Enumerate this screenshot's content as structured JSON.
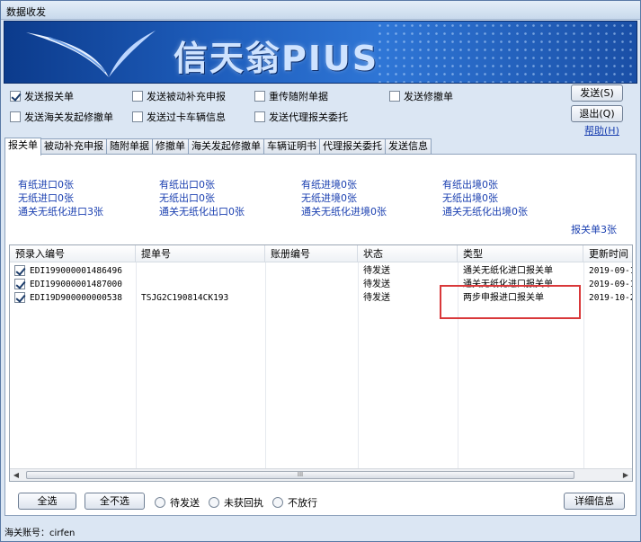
{
  "window": {
    "title": "数据收发"
  },
  "banner": {
    "brand_text": "信天翁PIUS"
  },
  "options": [
    {
      "label": "发送报关单",
      "checked": true
    },
    {
      "label": "发送被动补充申报",
      "checked": false
    },
    {
      "label": "重传随附单据",
      "checked": false
    },
    {
      "label": "发送修撤单",
      "checked": false
    },
    {
      "label": "发送海关发起修撤单",
      "checked": false
    },
    {
      "label": "发送过卡车辆信息",
      "checked": false
    },
    {
      "label": "发送代理报关委托",
      "checked": false
    }
  ],
  "buttons": {
    "send": "发送(S)",
    "back": "退出(Q)",
    "help": "帮助(H)"
  },
  "tabs": [
    "报关单",
    "被动补充申报",
    "随附单据",
    "修撤单",
    "海关发起修撤单",
    "车辆证明书",
    "代理报关委托",
    "发送信息"
  ],
  "stats": {
    "col1": [
      "有纸进口0张",
      "无纸进口0张",
      "通关无纸化进口3张"
    ],
    "col2": [
      "有纸出口0张",
      "无纸出口0张",
      "通关无纸化出口0张"
    ],
    "col3": [
      "有纸进境0张",
      "无纸进境0张",
      "通关无纸化进境0张"
    ],
    "col4": [
      "有纸出境0张",
      "无纸出境0张",
      "通关无纸化出境0张"
    ],
    "total": "报关单3张"
  },
  "table": {
    "columns": [
      "预录入编号",
      "提单号",
      "账册编号",
      "状态",
      "类型",
      "更新时间"
    ],
    "rows": [
      {
        "checked": true,
        "id": "EDI199000001486496",
        "bill": "",
        "book": "",
        "status": "待发送",
        "type": "通关无纸化进口报关单",
        "time": "2019-09-1"
      },
      {
        "checked": true,
        "id": "EDI199000001487000",
        "bill": "",
        "book": "",
        "status": "待发送",
        "type": "通关无纸化进口报关单",
        "time": "2019-09-1"
      },
      {
        "checked": true,
        "id": "EDI19D900000000538",
        "bill": "TSJG2C190814CK193",
        "book": "",
        "status": "待发送",
        "type": "两步申报进口报关单",
        "time": "2019-10-2"
      }
    ],
    "scroll_grip": "III"
  },
  "bottom": {
    "select_all": "全选",
    "select_none": "全不选",
    "filters": [
      "待发送",
      "未获回执",
      "不放行"
    ],
    "details": "详细信息"
  },
  "statusbar": {
    "text": "海关账号：cirfen"
  }
}
